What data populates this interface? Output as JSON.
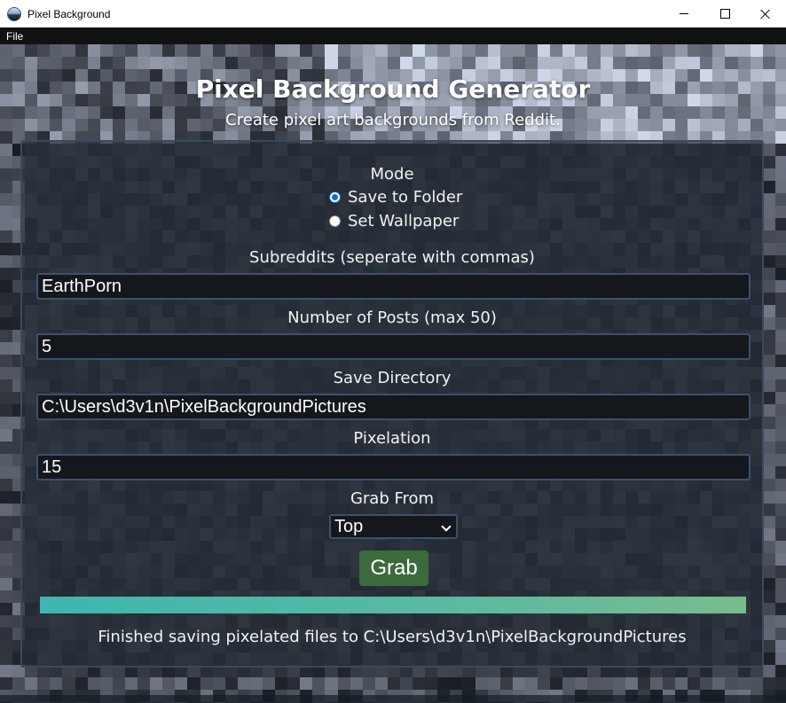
{
  "window": {
    "title": "Pixel Background",
    "menu": [
      "File"
    ]
  },
  "header": {
    "title": "Pixel Background Generator",
    "subtitle": "Create pixel art backgrounds from Reddit."
  },
  "form": {
    "mode_label": "Mode",
    "mode_options": [
      {
        "label": "Save to Folder",
        "selected": true
      },
      {
        "label": "Set Wallpaper",
        "selected": false
      }
    ],
    "subreddits_label": "Subreddits (seperate with commas)",
    "subreddits_value": "EarthPorn",
    "posts_label": "Number of Posts (max 50)",
    "posts_value": "5",
    "directory_label": "Save Directory",
    "directory_value": "C:\\Users\\d3v1n\\PixelBackgroundPictures",
    "pixelation_label": "Pixelation",
    "pixelation_value": "15",
    "grab_from_label": "Grab From",
    "grab_from_value": "Top",
    "grab_button": "Grab"
  },
  "progress": {
    "value": 1.0,
    "color_start": "#3fb6b0",
    "color_end": "#79bb8e"
  },
  "status": "Finished saving pixelated files to C:\\Users\\d3v1n\\PixelBackgroundPictures",
  "colors": {
    "button_bg": "#3b6b3c",
    "field_border": "#3e506a",
    "panel_border": "#3a4a60"
  }
}
